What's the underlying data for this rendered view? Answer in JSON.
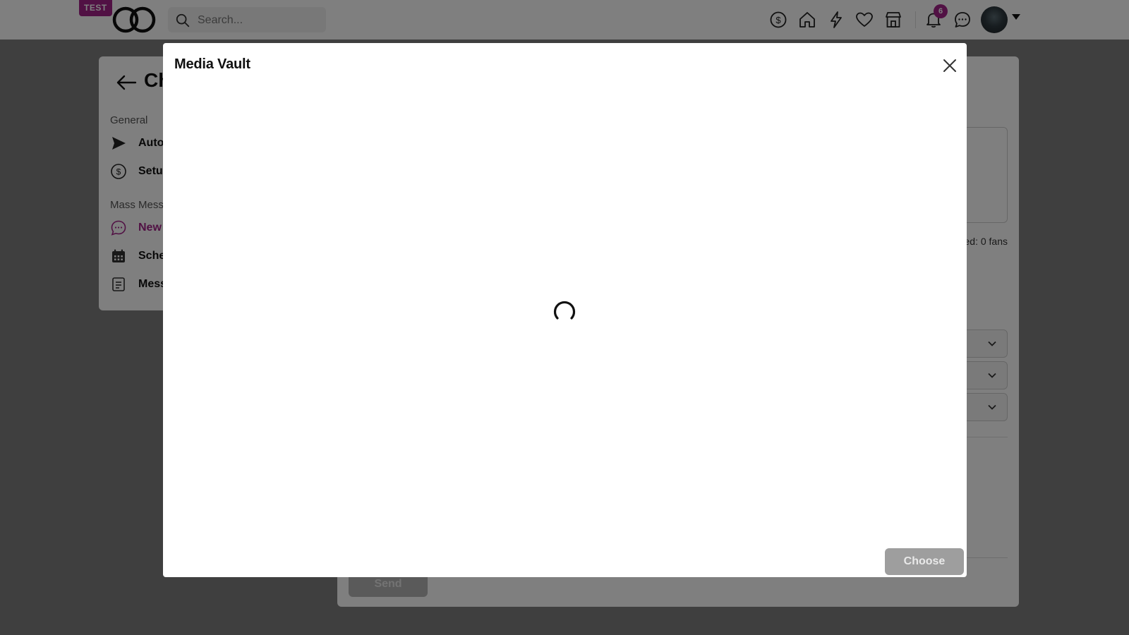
{
  "header": {
    "test_badge": "TEST",
    "search_placeholder": "Search...",
    "notification_count": "6",
    "accent_color": "#a32389"
  },
  "sidebar": {
    "title": "Ch",
    "sections": [
      {
        "label": "General",
        "items": [
          {
            "label": "Auto",
            "icon": "send-icon"
          },
          {
            "label": "Setu",
            "icon": "dollar-icon"
          }
        ]
      },
      {
        "label": "Mass Mess",
        "items": [
          {
            "label": "New",
            "icon": "chat-icon",
            "active": true
          },
          {
            "label": "Sche",
            "icon": "calendar-icon"
          },
          {
            "label": "Mess",
            "icon": "document-icon"
          }
        ]
      }
    ]
  },
  "main": {
    "fans_text": "ed: 0 fans",
    "send_label": "Send"
  },
  "modal": {
    "title": "Media Vault",
    "choose_label": "Choose",
    "loading": true
  }
}
